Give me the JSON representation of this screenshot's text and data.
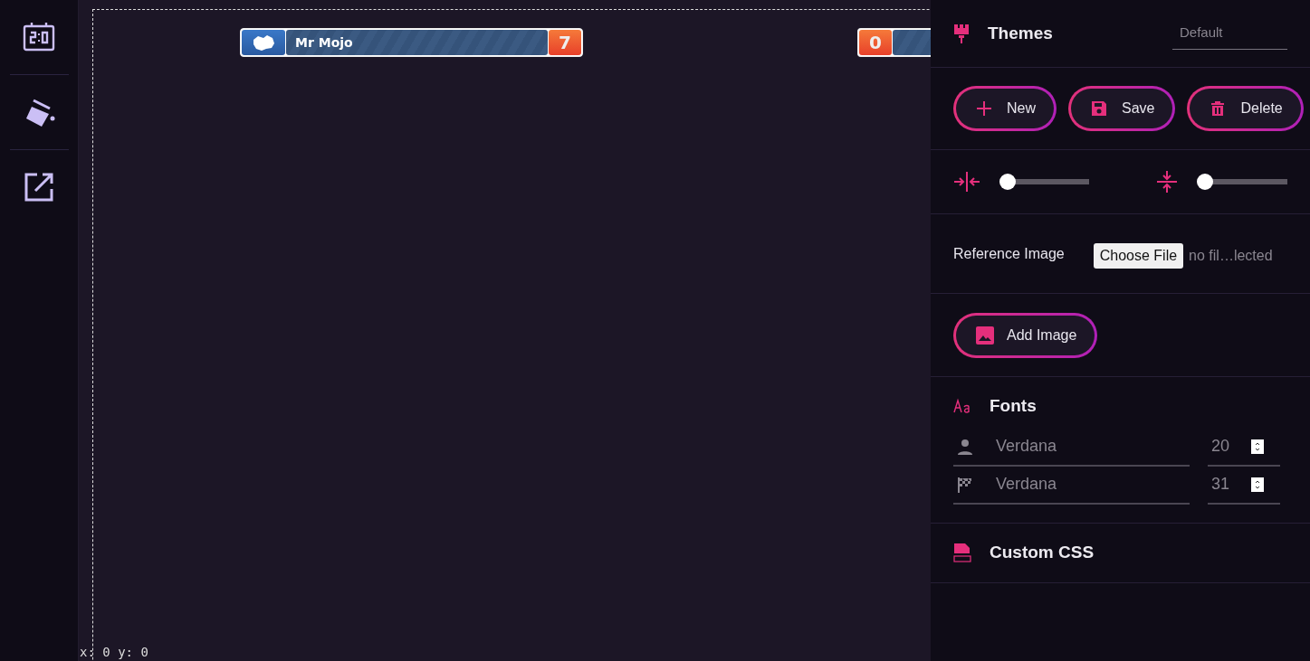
{
  "sidebar": {
    "items": [
      {
        "kind": "scoreboard"
      },
      {
        "kind": "paint"
      },
      {
        "kind": "external"
      }
    ]
  },
  "canvas": {
    "scoreboards": [
      {
        "kind": "home",
        "name": "Mr Mojo",
        "score": "7"
      },
      {
        "kind": "away",
        "score": "0"
      }
    ],
    "cursor_readout": "x: 0 y: 0"
  },
  "panel": {
    "themes": {
      "title": "Themes",
      "select_placeholder": "Default"
    },
    "buttons": [
      {
        "kind": "add",
        "label": "New"
      },
      {
        "kind": "save",
        "label": "Save"
      },
      {
        "kind": "delete",
        "label": "Delete"
      }
    ],
    "sliders": [
      {
        "kind": "horizontal",
        "level": 0
      },
      {
        "kind": "vertical",
        "level": 0
      }
    ],
    "reference_image": {
      "label": "Reference Image",
      "button": "Choose File",
      "file_name": "no fil…lected"
    },
    "add_image_button": "Add Image",
    "fonts": {
      "title": "Fonts",
      "rows": [
        {
          "kind": "player",
          "placeholder": "Verdana",
          "size": "20"
        },
        {
          "kind": "score",
          "placeholder": "Verdana",
          "size": "31"
        }
      ]
    },
    "custom_css": {
      "title": "Custom CSS"
    }
  }
}
